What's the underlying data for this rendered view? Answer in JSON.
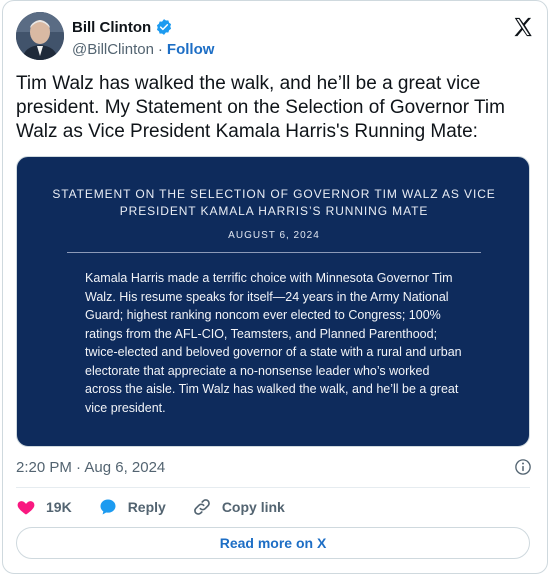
{
  "author": {
    "name": "Bill Clinton",
    "handle": "@BillClinton",
    "separator": "·",
    "follow_label": "Follow"
  },
  "tweet_text": "Tim Walz has walked the walk, and he’ll be a great vice president. My Statement on the Selection of Governor Tim Walz as Vice President Kamala Harris's Running Mate:",
  "statement": {
    "title": "STATEMENT ON THE SELECTION OF GOVERNOR TIM WALZ AS VICE PRESIDENT KAMALA HARRIS’S RUNNING MATE",
    "date": "AUGUST 6, 2024",
    "body": "Kamala Harris made a terrific choice with Minnesota Governor Tim Walz. His resume speaks for itself—24 years in the Army National Guard; highest ranking noncom ever elected to Congress; 100% ratings from the AFL-CIO, Teamsters, and Planned Parenthood; twice-elected and beloved governor of a state with a rural and urban electorate that appreciate a no-nonsense leader who’s worked across the aisle. Tim Walz has walked the walk, and he’ll be a great vice president."
  },
  "timestamp": "2:20 PM · Aug 6, 2024",
  "actions": {
    "likes": "19K",
    "reply_label": "Reply",
    "copy_link_label": "Copy link"
  },
  "read_more_label": "Read more on X",
  "colors": {
    "accent": "#1d6ec5",
    "verified": "#1d9bf0",
    "heart": "#f91880",
    "statement_bg": "#0e2b5c"
  },
  "icons": [
    "verified-badge-icon",
    "x-logo-icon",
    "info-icon",
    "heart-icon",
    "reply-bubble-icon",
    "link-icon"
  ]
}
